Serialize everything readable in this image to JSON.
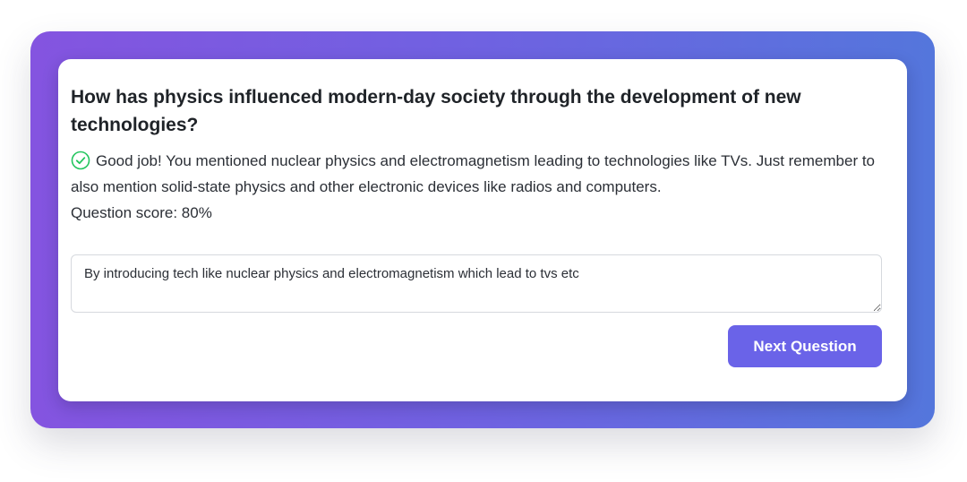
{
  "quiz": {
    "question": "How has physics influenced modern-day society through the development of new technologies?",
    "feedback": {
      "icon": "check-circle-icon",
      "icon_color": "#22c55e",
      "text": "Good job! You mentioned nuclear physics and electromagnetism leading to technologies like TVs. Just remember to also mention solid-state physics and other electronic devices like radios and computers.",
      "score_text": "Question score: 80%"
    },
    "answer": {
      "value": "By introducing tech like nuclear physics and electromagnetism which lead to tvs etc"
    },
    "next_button_label": "Next Question"
  },
  "colors": {
    "accent": "#6a63e8",
    "gradient_start": "#8454e0",
    "gradient_end": "#5476dc"
  }
}
